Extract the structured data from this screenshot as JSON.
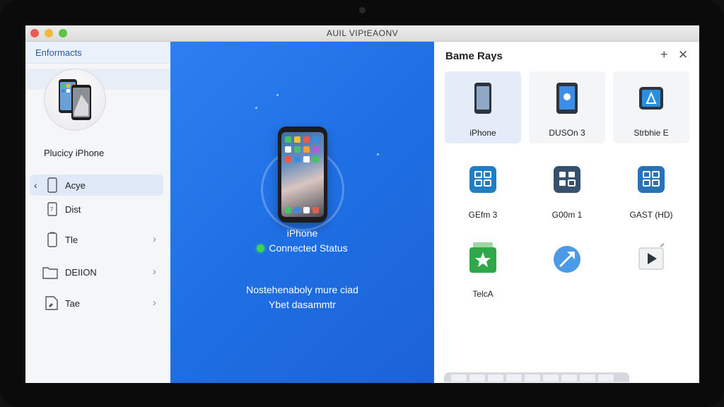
{
  "window": {
    "title": "AUIL VIPtEAONV"
  },
  "sidebar": {
    "header": "Enformacts",
    "device_name": "Plucicy iPhone",
    "items": [
      {
        "label": "Acye",
        "chevron": "‹",
        "active": true
      },
      {
        "label": "Dist",
        "chevron": ""
      },
      {
        "label": "Tle",
        "chevron": "›"
      },
      {
        "label": "DEIION",
        "chevron": "›"
      },
      {
        "label": "Tae",
        "chevron": "›"
      }
    ]
  },
  "center": {
    "device_label": "iPhone",
    "status": "Connected Status",
    "message_line1": "Nostehenaboly mure ciad",
    "message_line2": "Ybet dasammtr",
    "status_color": "#3fd35a"
  },
  "panel": {
    "title": "Bame Rays",
    "add_glyph": "+",
    "close_glyph": "✕",
    "tiles": [
      {
        "label": "iPhone",
        "icon": "phone-icon"
      },
      {
        "label": "DUSOn 3",
        "icon": "tablet-icon"
      },
      {
        "label": "Strbhie E",
        "icon": "display-app-icon"
      },
      {
        "label": "GEfm 3",
        "icon": "grid-app-icon"
      },
      {
        "label": "G00m 1",
        "icon": "grid-app-icon"
      },
      {
        "label": "GAST (HD)",
        "icon": "grid-app-icon"
      },
      {
        "label": "TelcA",
        "icon": "star-app-icon"
      },
      {
        "label": "",
        "icon": "share-arrow-icon"
      },
      {
        "label": "",
        "icon": "play-icon"
      }
    ]
  },
  "colors": {
    "accent_blue": "#2d7ff0",
    "selected_tile": "#e3ecf8"
  }
}
